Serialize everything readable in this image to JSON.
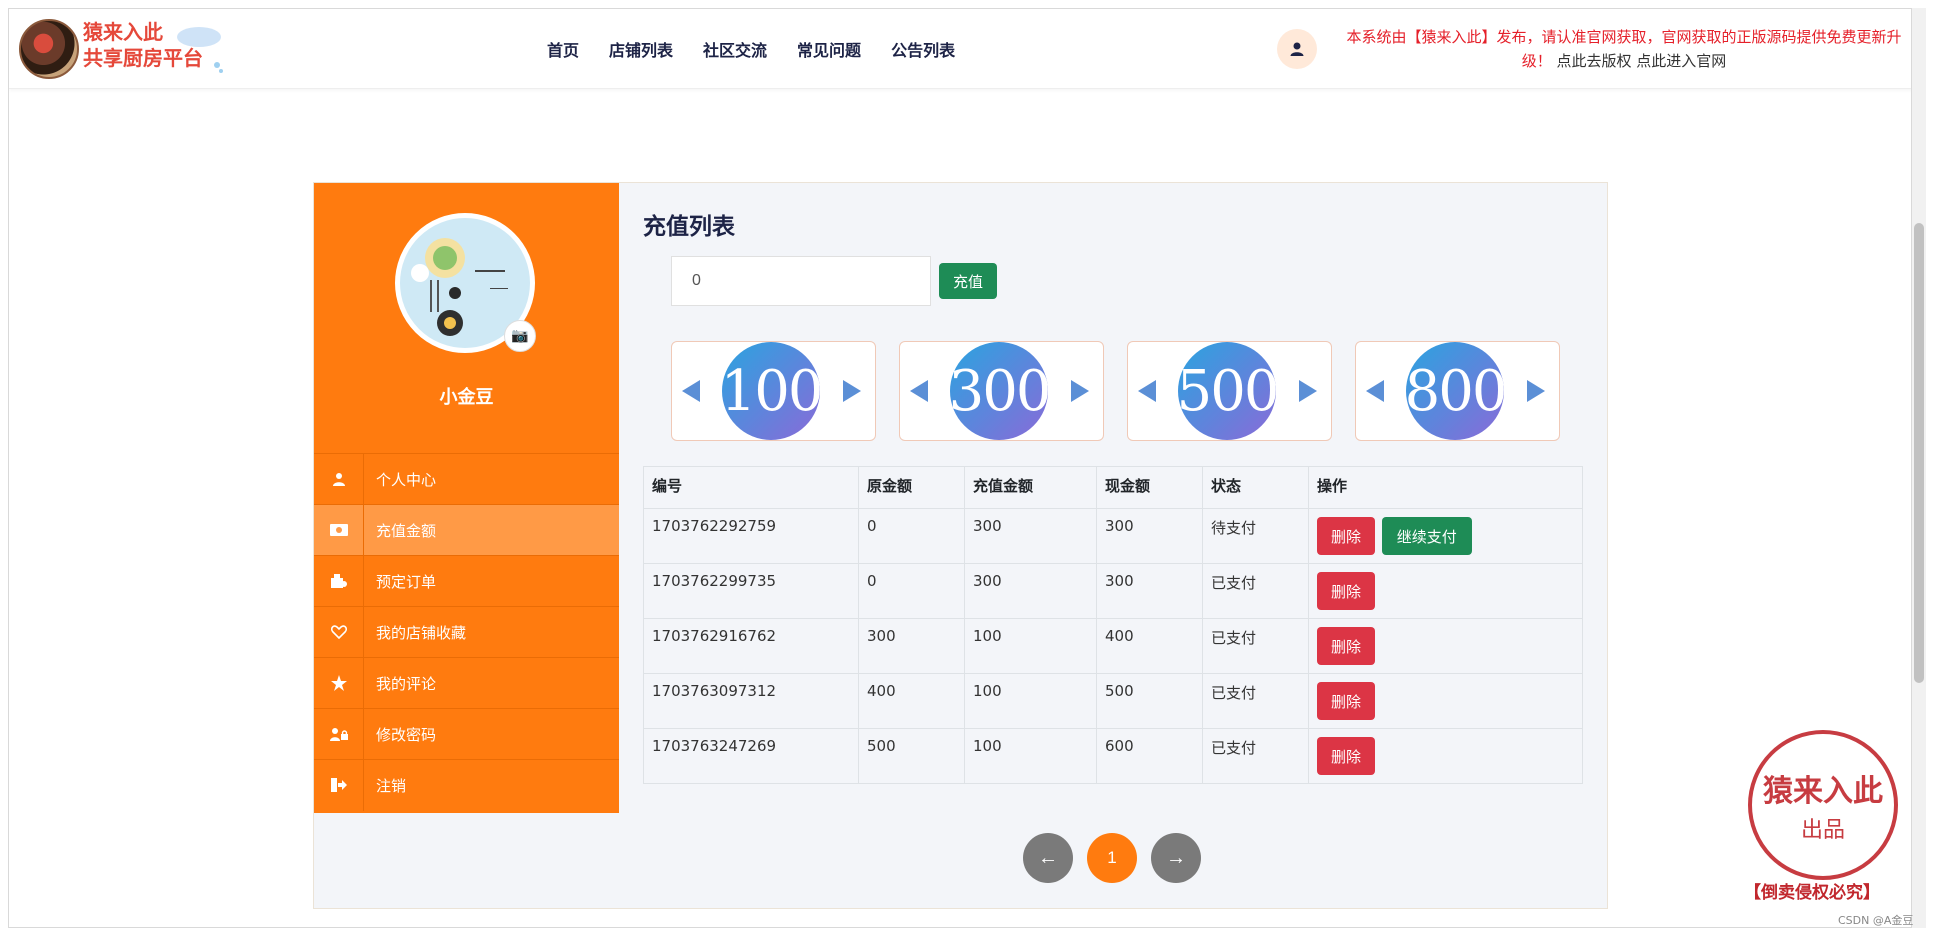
{
  "header": {
    "brand_line1": "猿来入此",
    "brand_line2": "共享厨房平台",
    "nav": [
      "首页",
      "店铺列表",
      "社区交流",
      "常见问题",
      "公告列表"
    ],
    "notice_part1": "本系统由【猿来入此】发布，请认准官网获取，官网获取的正版源码提供免费更新升级！",
    "notice_link1": "点此去版权",
    "notice_link2": "点此进入官网"
  },
  "sidebar": {
    "username": "小金豆",
    "menu": [
      {
        "label": "个人中心",
        "icon": "user-icon"
      },
      {
        "label": "充值金额",
        "icon": "money-icon"
      },
      {
        "label": "预定订单",
        "icon": "order-icon"
      },
      {
        "label": "我的店铺收藏",
        "icon": "heart-icon"
      },
      {
        "label": "我的评论",
        "icon": "star-icon"
      },
      {
        "label": "修改密码",
        "icon": "users-lock-icon"
      },
      {
        "label": "注销",
        "icon": "logout-icon"
      }
    ]
  },
  "main": {
    "title": "充值列表",
    "amount_value": "0",
    "charge_label": "充值",
    "quick_amounts": [
      "100",
      "300",
      "500",
      "800"
    ],
    "table": {
      "headers": [
        "编号",
        "原金额",
        "充值金额",
        "现金额",
        "状态",
        "操作"
      ],
      "rows": [
        {
          "id": "1703762292759",
          "orig": "0",
          "charge": "300",
          "now": "300",
          "status": "待支付",
          "delete": "删除",
          "continue": "继续支付"
        },
        {
          "id": "1703762299735",
          "orig": "0",
          "charge": "300",
          "now": "300",
          "status": "已支付",
          "delete": "删除"
        },
        {
          "id": "1703762916762",
          "orig": "300",
          "charge": "100",
          "now": "400",
          "status": "已支付",
          "delete": "删除"
        },
        {
          "id": "1703763097312",
          "orig": "400",
          "charge": "100",
          "now": "500",
          "status": "已支付",
          "delete": "删除"
        },
        {
          "id": "1703763247269",
          "orig": "500",
          "charge": "100",
          "now": "600",
          "status": "已支付",
          "delete": "删除"
        }
      ]
    },
    "pager": {
      "prev": "←",
      "current": "1",
      "next": "→"
    }
  },
  "stamp": {
    "main": "猿来入此",
    "sub": "出品",
    "bottom": "【倒卖侵权必究】"
  },
  "watermark": "CSDN @A金豆",
  "colors": {
    "primary": "#ff7b0f",
    "success": "#1e8c56",
    "danger": "#dc3545",
    "notice": "#e5202a"
  }
}
